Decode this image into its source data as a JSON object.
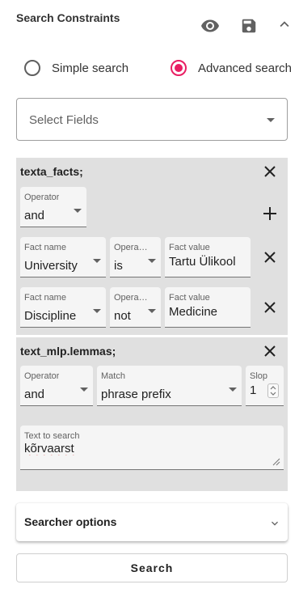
{
  "header": {
    "title": "Search Constraints",
    "icons": [
      "eye-icon",
      "save-icon",
      "chevron-up-icon"
    ]
  },
  "search_mode": {
    "simple_label": "Simple search",
    "advanced_label": "Advanced search",
    "selected": "advanced"
  },
  "select_fields": {
    "placeholder": "Select Fields"
  },
  "facts_block": {
    "title": "texta_facts;",
    "operator": {
      "label": "Operator",
      "value": "and"
    },
    "rows": [
      {
        "name_label": "Fact name",
        "name_value": "University",
        "op_label": "Opera…",
        "op_value": "is",
        "fact_label": "Fact value",
        "fact_value": "Tartu Ülikool"
      },
      {
        "name_label": "Fact name",
        "name_value": "Discipline",
        "op_label": "Opera…",
        "op_value": "not",
        "fact_label": "Fact value",
        "fact_value": "Medicine"
      }
    ]
  },
  "lemmas_block": {
    "title": "text_mlp.lemmas;",
    "operator": {
      "label": "Operator",
      "value": "and"
    },
    "match": {
      "label": "Match",
      "value": "phrase prefix"
    },
    "slop": {
      "label": "Slop",
      "value": "1"
    },
    "text_to_search": {
      "label": "Text to search",
      "value": "kõrvaarst"
    }
  },
  "searcher_options": {
    "label": "Searcher options"
  },
  "search_button": {
    "label": "Search"
  },
  "colors": {
    "accent": "#e91e63",
    "panel": "#e0e0e0",
    "field_bg": "#f5f5f5"
  }
}
